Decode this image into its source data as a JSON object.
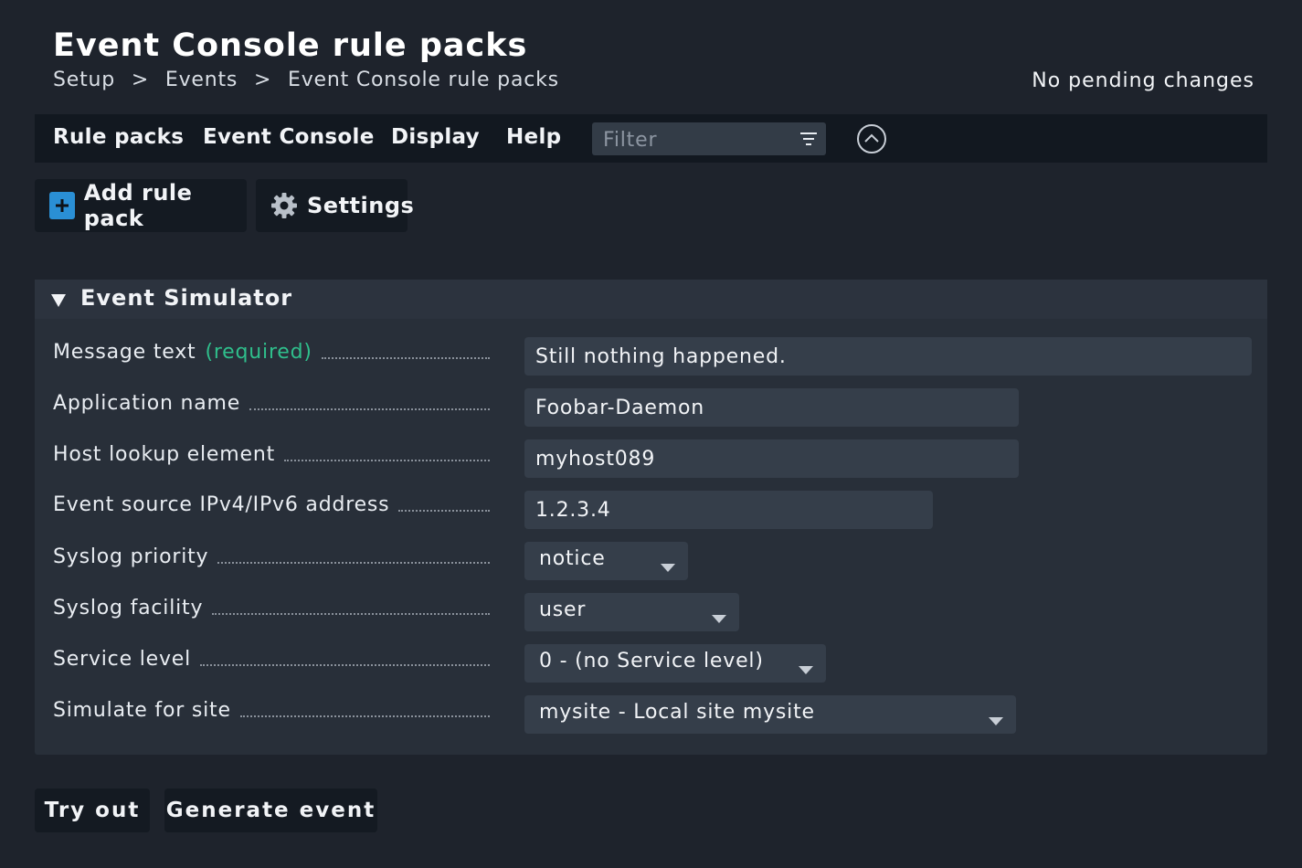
{
  "header": {
    "title": "Event Console rule packs",
    "breadcrumb": [
      "Setup",
      ">",
      "Events",
      ">",
      "Event Console rule packs"
    ],
    "pending": "No pending changes"
  },
  "menu": {
    "items": [
      "Rule packs",
      "Event Console",
      "Display",
      "Help"
    ],
    "filter_placeholder": "Filter",
    "filter_icon": "filter-lines-icon",
    "collapse_icon": "chevron-up-circle-icon"
  },
  "toolbar": {
    "add_label": "Add rule pack",
    "settings_label": "Settings"
  },
  "simulator": {
    "title": "Event Simulator",
    "fields": {
      "message_label": "Message text",
      "message_required": "(required)",
      "message_value": "Still nothing happened.",
      "app_label": "Application name",
      "app_value": "Foobar-Daemon",
      "host_label": "Host lookup element",
      "host_value": "myhost089",
      "source_label": "Event source IPv4/IPv6 address",
      "source_value": "1.2.3.4",
      "priority_label": "Syslog priority",
      "priority_value": "notice",
      "facility_label": "Syslog facility",
      "facility_value": "user",
      "service_label": "Service level",
      "service_value": "0 - (no Service level)",
      "site_label": "Simulate for site",
      "site_value": "mysite - Local site mysite"
    }
  },
  "actions": {
    "try_out": "Try out",
    "generate": "Generate event"
  },
  "colors": {
    "background": "#1e232c",
    "menubar": "#121820",
    "accent_blue": "#2a8fd5",
    "required_green": "#2fbf8c"
  }
}
